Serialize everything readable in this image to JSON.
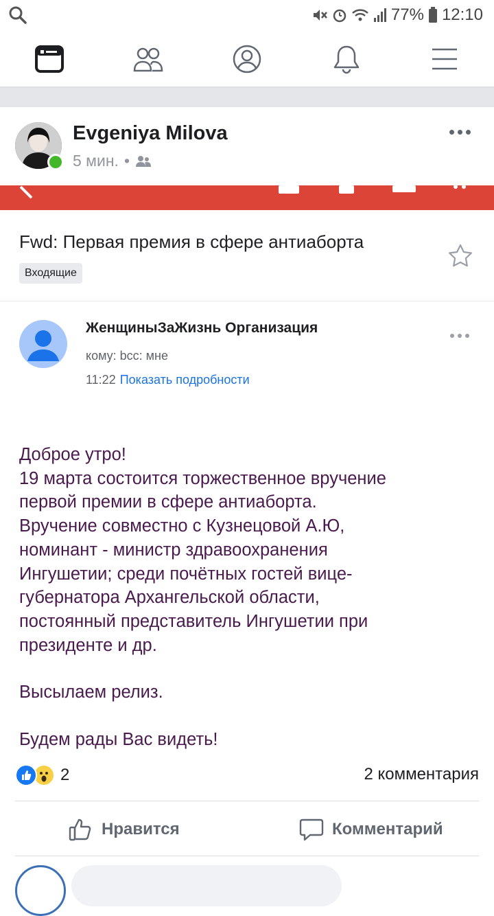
{
  "status": {
    "battery": "77%",
    "time": "12:10"
  },
  "nav": {
    "items": [
      "news-feed",
      "friends",
      "profile",
      "notifications",
      "menu"
    ]
  },
  "post": {
    "author": "Evgeniya Milova",
    "time": "5 мин.",
    "dot": "•",
    "reactions_count": "2",
    "comments_count": "2 комментария",
    "like_label": "Нравится",
    "comment_label": "Комментарий"
  },
  "email": {
    "subject": "Fwd: Первая премия в сфере антиаборта",
    "label_chip": "Входящие",
    "sender": "ЖенщиныЗаЖизнь Организация",
    "to": "кому: bcc: мне",
    "time": "11:22",
    "details_link": "Показать подробности",
    "body_lines": [
      "Доброе утро!",
      "19 марта состоится торжественное вручение",
      "первой премии в сфере антиаборта.",
      "Вручение совместно с Кузнецовой А.Ю,",
      "номинант - министр здравоохранения",
      "Ингушетии; среди почётных гостей вице-",
      "губернатора Архангельской области,",
      "постоянный представитель Ингушетии при",
      "президенте и др."
    ],
    "body_p2": "Высылаем релиз.",
    "body_p3": "Будем рады Вас видеть!"
  },
  "colors": {
    "email_header": "#db4437",
    "body_text": "#4a1a4f",
    "online": "#42b72a",
    "link": "#1a73e8"
  }
}
